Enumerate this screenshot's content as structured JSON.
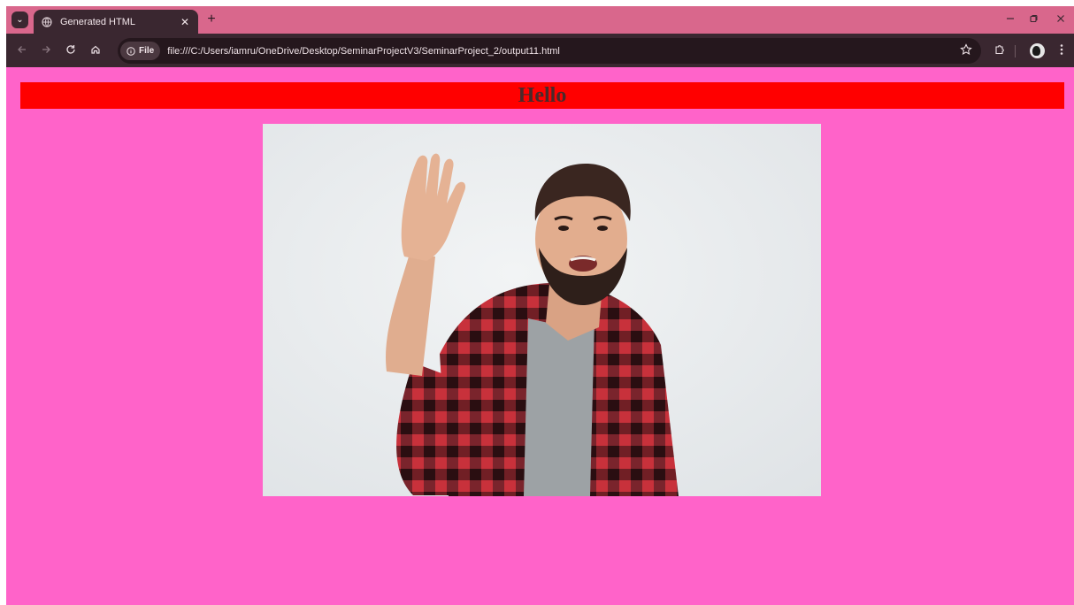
{
  "browser": {
    "tab": {
      "title": "Generated HTML",
      "close_glyph": "✕",
      "favicon": "globe-icon"
    },
    "new_tab_glyph": "+",
    "toolbar": {
      "back_icon": "back-arrow-icon",
      "forward_icon": "forward-arrow-icon",
      "reload_icon": "reload-icon",
      "home_icon": "home-icon",
      "site_chip_label": "File",
      "url": "file:///C:/Users/iamru/OneDrive/Desktop/SeminarProjectV3/SeminarProject_2/output11.html",
      "bookmark_icon": "star-icon",
      "extensions_icon": "puzzle-icon",
      "menu_icon": "kebab-menu-icon"
    },
    "window_controls": [
      "minimize-icon",
      "restore-icon",
      "close-icon"
    ]
  },
  "page": {
    "heading": "Hello",
    "colors": {
      "background": "#ff63c9",
      "banner": "#ff0000",
      "heading_text": "#4a2a2a"
    },
    "image": {
      "subject": "man-waving-photo"
    }
  }
}
